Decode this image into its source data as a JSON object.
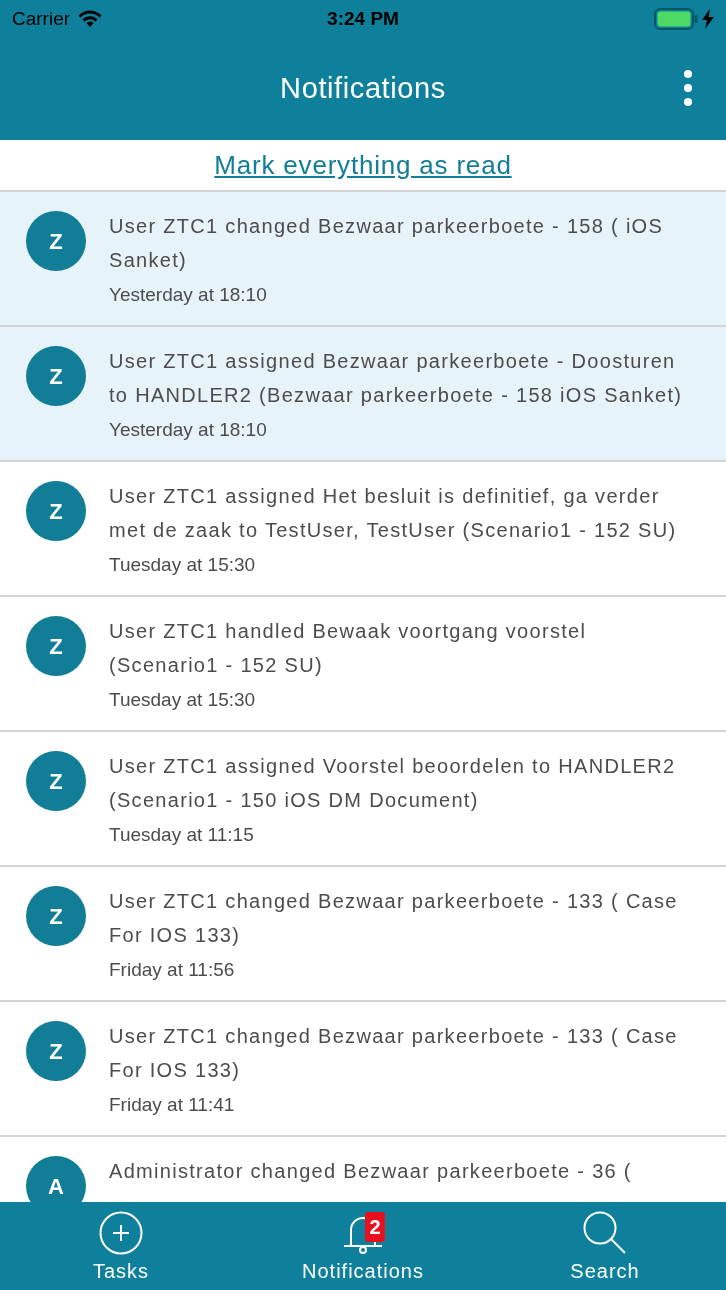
{
  "status_bar": {
    "carrier": "Carrier",
    "time": "3:24 PM"
  },
  "header": {
    "title": "Notifications"
  },
  "mark_all_link": "Mark everything as read",
  "notifications": [
    {
      "initial": "Z",
      "message": "User ZTC1 changed Bezwaar parkeerboete - 158 ( iOS Sanket)",
      "time": "Yesterday at 18:10",
      "unread": true
    },
    {
      "initial": "Z",
      "message": "User ZTC1 assigned Bezwaar parkeerboete - Doosturen to HANDLER2 (Bezwaar parkeerboete - 158 iOS Sanket)",
      "time": "Yesterday at 18:10",
      "unread": true
    },
    {
      "initial": "Z",
      "message": "User ZTC1 assigned Het besluit is definitief, ga verder met de zaak to TestUser, TestUser (Scenario1 - 152 SU)",
      "time": "Tuesday at 15:30",
      "unread": false
    },
    {
      "initial": "Z",
      "message": "User ZTC1 handled Bewaak voortgang voorstel (Scenario1 - 152 SU)",
      "time": "Tuesday at 15:30",
      "unread": false
    },
    {
      "initial": "Z",
      "message": "User ZTC1 assigned Voorstel beoordelen to HANDLER2 (Scenario1 - 150 iOS DM Document)",
      "time": "Tuesday at 11:15",
      "unread": false
    },
    {
      "initial": "Z",
      "message": "User ZTC1 changed Bezwaar parkeerboete - 133 ( Case For IOS 133)",
      "time": "Friday at 11:56",
      "unread": false
    },
    {
      "initial": "Z",
      "message": "User ZTC1 changed Bezwaar parkeerboete - 133 ( Case For IOS 133)",
      "time": "Friday at 11:41",
      "unread": false
    },
    {
      "initial": "A",
      "message": "Administrator changed Bezwaar parkeerboete - 36 (",
      "unread": false
    }
  ],
  "tab_bar": [
    {
      "kind": "tasks",
      "label": "Tasks"
    },
    {
      "kind": "notifications",
      "label": "Notifications",
      "badge": "2"
    },
    {
      "kind": "search",
      "label": "Search"
    }
  ]
}
